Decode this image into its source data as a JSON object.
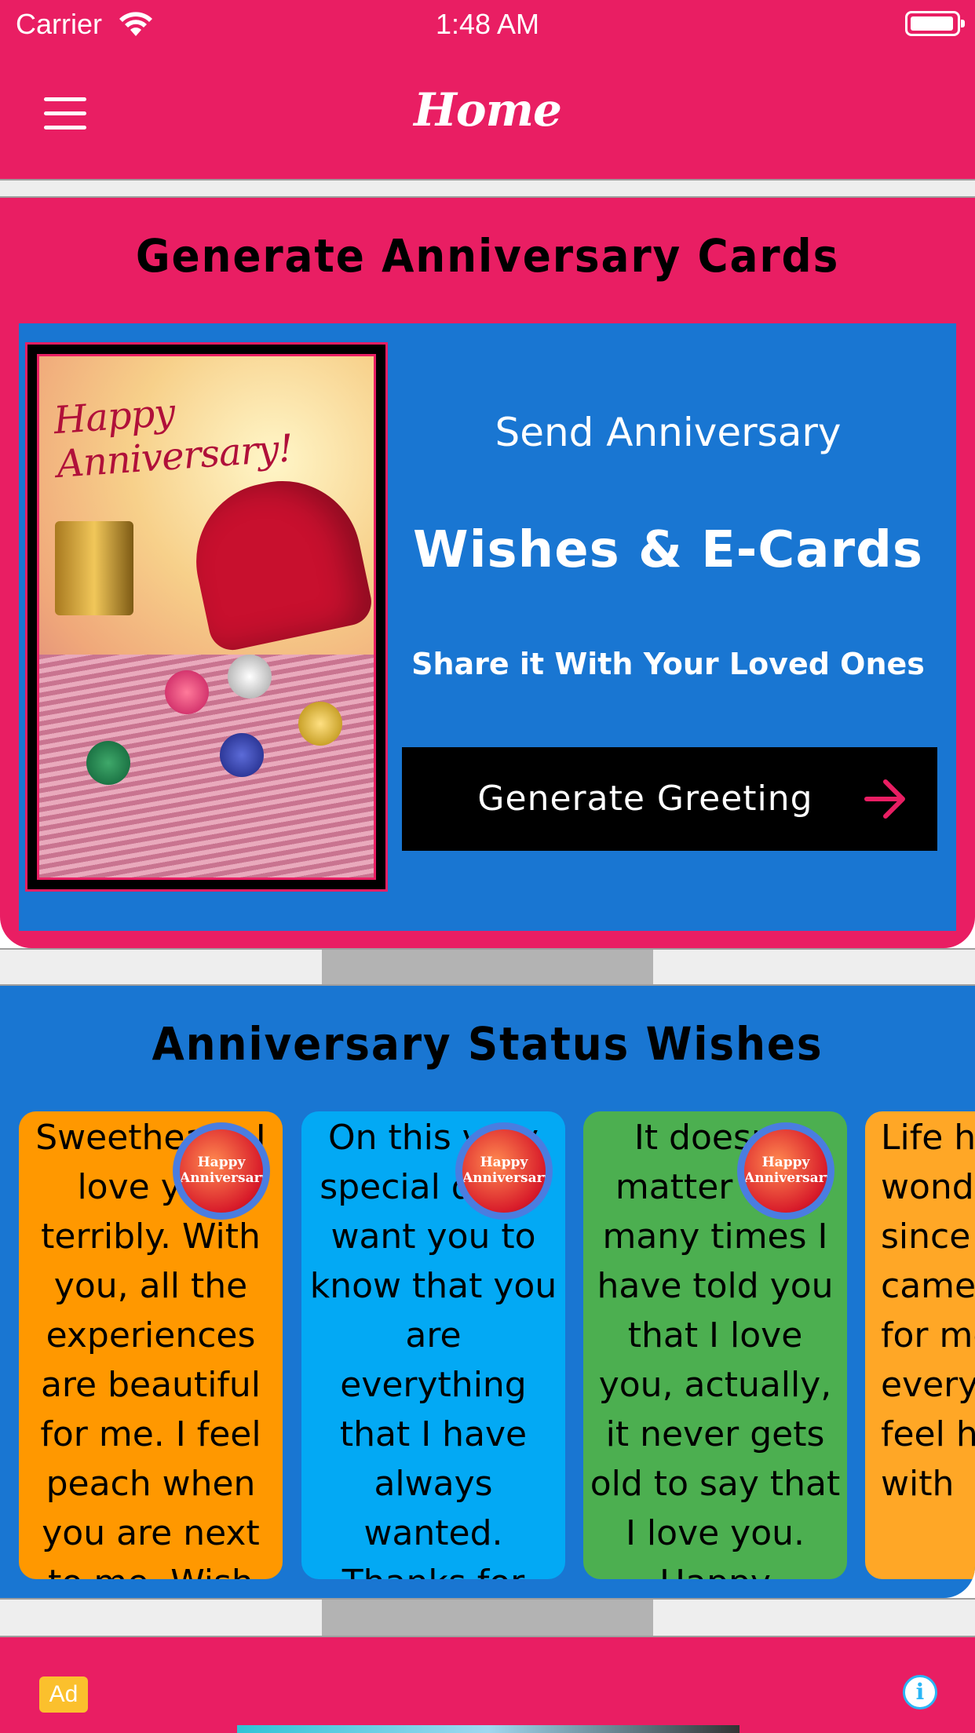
{
  "status_bar": {
    "carrier": "Carrier",
    "time": "1:48 AM"
  },
  "nav": {
    "title": "Home",
    "menu_icon": "hamburger-menu-icon"
  },
  "cards_section": {
    "title": "Generate Anniversary Cards",
    "card_image_text": "Happy Anniversary!",
    "send_line1": "Send Anniversary",
    "send_line2": "Wishes & E-Cards",
    "send_line3": "Share it With Your Loved Ones",
    "button_label": "Generate Greeting",
    "button_icon": "arrow-right-icon",
    "accent_color": "#e91e63",
    "panel_color": "#1976d2"
  },
  "wishes_section": {
    "title": "Anniversary Status Wishes",
    "avatar_text": "Happy Anniversary",
    "cards": [
      {
        "text": "Sweetheart, I love you terribly. With you, all the experiences are beautiful for me. I feel peach when you are next to me. Wish",
        "color": "#ff9800"
      },
      {
        "text": "On this very special day, I want you to know that you are everything that I have always wanted. Thanks for being with me",
        "color": "#03a9f4"
      },
      {
        "text": "It doesn't matter how many times I have told you that I love you, actually, it never gets old to say that I love you. Happy",
        "color": "#4caf50"
      },
      {
        "text": "Life has been wonderful since you came there for me and every time I feel happy with",
        "color": "#ffa726"
      }
    ]
  },
  "ad": {
    "badge": "Ad",
    "info_icon": "info-icon"
  }
}
